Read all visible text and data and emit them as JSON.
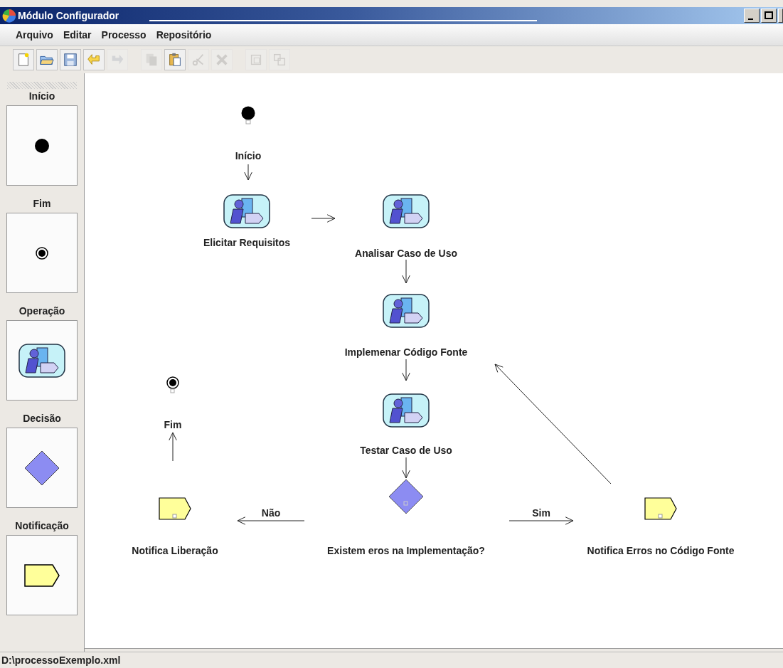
{
  "window": {
    "title": "Módulo Configurador"
  },
  "menu": [
    {
      "label": "Arquivo"
    },
    {
      "label": "Editar"
    },
    {
      "label": "Processo"
    },
    {
      "label": "Repositório"
    }
  ],
  "toolbar": [
    {
      "kind": "new",
      "disabled": false
    },
    {
      "kind": "open",
      "disabled": false
    },
    {
      "kind": "save",
      "disabled": false
    },
    {
      "kind": "undo",
      "disabled": false
    },
    {
      "kind": "redo",
      "disabled": true
    },
    {
      "kind": "sep"
    },
    {
      "kind": "copy",
      "disabled": true
    },
    {
      "kind": "paste",
      "disabled": false
    },
    {
      "kind": "cut",
      "disabled": true
    },
    {
      "kind": "delete",
      "disabled": true
    },
    {
      "kind": "sep"
    },
    {
      "kind": "group",
      "disabled": true
    },
    {
      "kind": "ungroup",
      "disabled": true
    }
  ],
  "palette": [
    {
      "kind": "start",
      "label": "Início"
    },
    {
      "kind": "end",
      "label": "Fim"
    },
    {
      "kind": "operation",
      "label": "Operação"
    },
    {
      "kind": "decision",
      "label": "Decisão"
    },
    {
      "kind": "notification",
      "label": "Notificação"
    }
  ],
  "diagram": {
    "nodes": [
      {
        "kind": "start",
        "label": "Início"
      },
      {
        "kind": "operation",
        "label": "Elicitar Requisitos"
      },
      {
        "kind": "operation",
        "label": "Analisar Caso de Uso"
      },
      {
        "kind": "operation",
        "label": "Implemenar Código Fonte"
      },
      {
        "kind": "end",
        "label": "Fim"
      },
      {
        "kind": "operation",
        "label": "Testar Caso de Uso"
      },
      {
        "kind": "notification",
        "label": "Notifica Liberação"
      },
      {
        "kind": "decision",
        "label": "Existem eros na Implementação?"
      },
      {
        "kind": "notification",
        "label": "Notifica Erros no Código Fonte"
      }
    ],
    "connection_labels": [
      {
        "label": "Não"
      },
      {
        "label": "Sim"
      }
    ]
  },
  "status_bar": {
    "path": "D:\\processoExemplo.xml"
  }
}
